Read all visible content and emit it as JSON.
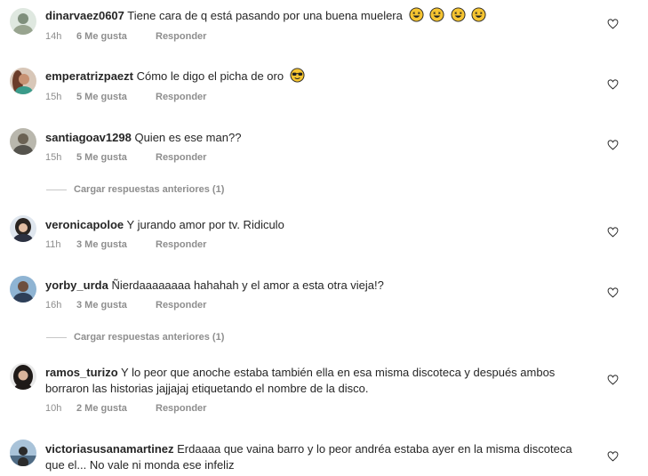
{
  "comments": [
    {
      "username": "dinarvaez0607",
      "text": "Tiene cara de q está pasando por una buena muelera",
      "emojis": [
        "rofl-emoji",
        "rofl-emoji",
        "rofl-emoji",
        "rofl-emoji"
      ],
      "time": "14h",
      "likes": "6 Me gusta",
      "reply": "Responder"
    },
    {
      "username": "emperatrizpaezt",
      "text": "Cómo le digo el picha de oro",
      "emojis": [
        "sunglasses-emoji"
      ],
      "time": "15h",
      "likes": "5 Me gusta",
      "reply": "Responder"
    },
    {
      "username": "santiagoav1298",
      "text": "Quien es ese man??",
      "emojis": [],
      "time": "15h",
      "likes": "5 Me gusta",
      "reply": "Responder"
    },
    {
      "username": "veronicapoloe",
      "text": "Y jurando amor por tv. Ridiculo",
      "emojis": [],
      "time": "11h",
      "likes": "3 Me gusta",
      "reply": "Responder"
    },
    {
      "username": "yorby_urda",
      "text": "Ñierdaaaaaaaa hahahah y el amor a esta otra vieja!?",
      "emojis": [],
      "time": "16h",
      "likes": "3 Me gusta",
      "reply": "Responder"
    },
    {
      "username": "ramos_turizo",
      "text": "Y lo peor que anoche estaba también ella en esa misma discoteca y después ambos borraron las historias jajjajaj etiquetando el nombre de la disco.",
      "emojis": [],
      "time": "10h",
      "likes": "2 Me gusta",
      "reply": "Responder"
    },
    {
      "username": "victoriasusanamartinez",
      "text": "Erdaaaa que vaina barro y lo peor andréa estaba ayer en la misma discoteca que el... No vale ni monda ese infeliz",
      "emojis": [],
      "time": "",
      "likes": "",
      "reply": ""
    }
  ],
  "load_more": [
    {
      "label": "Cargar respuestas anteriores (1)"
    },
    {
      "label": "Cargar respuestas anteriores (1)"
    }
  ],
  "icons": {
    "like": "heart-outline-icon"
  },
  "colors": {
    "primary_text": "#262626",
    "secondary_text": "#8e8e8e",
    "emoji": "#f7c531"
  }
}
